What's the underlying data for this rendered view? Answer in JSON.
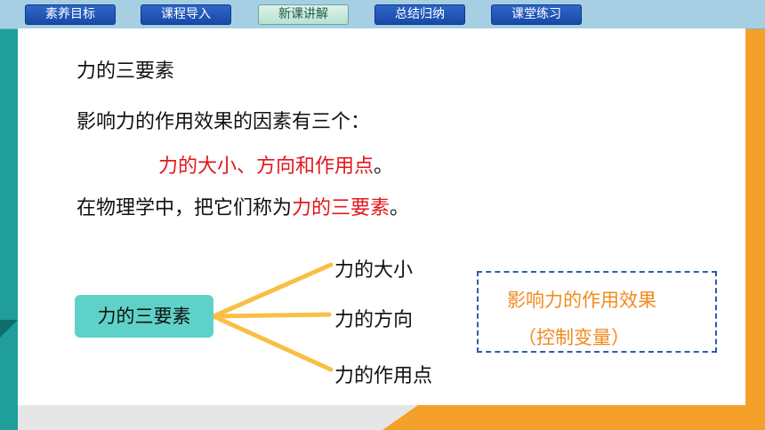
{
  "nav": {
    "items": [
      {
        "label": "素养目标"
      },
      {
        "label": "课程导入"
      },
      {
        "label": "新课讲解"
      },
      {
        "label": "总结归纳"
      },
      {
        "label": "课堂练习"
      }
    ],
    "active_index": 2
  },
  "content": {
    "heading": "力的三要素",
    "intro": "影响力的作用效果的因素有三个：",
    "factors_red": "力的大小、方向和作用点",
    "factors_end": "。",
    "conclusion_prefix": "在物理学中，把它们称为",
    "conclusion_red": "力的三要素",
    "conclusion_end": "。"
  },
  "diagram": {
    "root": "力的三要素",
    "branches": [
      "力的大小",
      "力的方向",
      "力的作用点"
    ],
    "note_line1": "影响力的作用效果",
    "note_line2": "（控制变量）"
  },
  "colors": {
    "accent_teal": "#1f9e9c",
    "accent_orange": "#f4a02a",
    "highlight_red": "#e3161b",
    "connector": "#f9bf45",
    "nav_blue": "#1e54b8"
  }
}
